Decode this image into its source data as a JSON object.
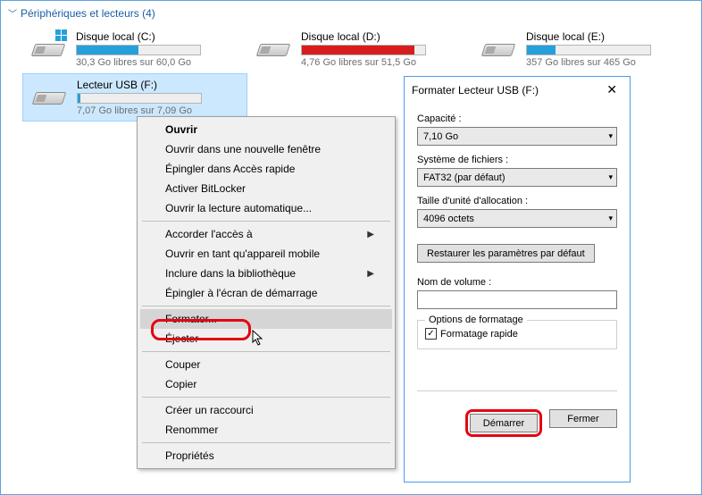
{
  "section": {
    "title": "Périphériques et lecteurs (4)"
  },
  "drives": [
    {
      "name": "Disque local (C:)",
      "sub": "30,3 Go libres sur 60,0 Go",
      "fill_pct": 50,
      "fill_color": "blue",
      "os_logo": true,
      "selected": false
    },
    {
      "name": "Disque local (D:)",
      "sub": "4,76 Go libres sur 51,5 Go",
      "fill_pct": 91,
      "fill_color": "red",
      "os_logo": false,
      "selected": false
    },
    {
      "name": "Disque local (E:)",
      "sub": "357 Go libres sur 465 Go",
      "fill_pct": 23,
      "fill_color": "blue",
      "os_logo": false,
      "selected": false
    },
    {
      "name": "Lecteur USB (F:)",
      "sub": "7,07 Go libres sur 7,09 Go",
      "fill_pct": 2,
      "fill_color": "blue",
      "os_logo": false,
      "selected": true
    }
  ],
  "context_menu": {
    "items": [
      {
        "label": "Ouvrir",
        "bold": true
      },
      {
        "label": "Ouvrir dans une nouvelle fenêtre"
      },
      {
        "label": "Épingler dans Accès rapide"
      },
      {
        "label": "Activer BitLocker"
      },
      {
        "label": "Ouvrir la lecture automatique..."
      },
      {
        "sep": true
      },
      {
        "label": "Accorder l'accès à",
        "submenu": true
      },
      {
        "label": "Ouvrir en tant qu'appareil mobile"
      },
      {
        "label": "Inclure dans la bibliothèque",
        "submenu": true
      },
      {
        "label": "Épingler à l'écran de démarrage"
      },
      {
        "sep": true
      },
      {
        "label": "Formater...",
        "hovered": true
      },
      {
        "label": "Éjecter"
      },
      {
        "sep": true
      },
      {
        "label": "Couper"
      },
      {
        "label": "Copier"
      },
      {
        "sep": true
      },
      {
        "label": "Créer un raccourci"
      },
      {
        "label": "Renommer"
      },
      {
        "sep": true
      },
      {
        "label": "Propriétés"
      }
    ]
  },
  "dialog": {
    "title": "Formater Lecteur USB (F:)",
    "capacity_label": "Capacité :",
    "capacity_value": "7,10 Go",
    "fs_label": "Système de fichiers :",
    "fs_value": "FAT32 (par défaut)",
    "alloc_label": "Taille d'unité d'allocation :",
    "alloc_value": "4096 octets",
    "restore_btn": "Restaurer les paramètres par défaut",
    "volume_label": "Nom de volume :",
    "volume_value": "",
    "options_legend": "Options de formatage",
    "quick_label": "Formatage rapide",
    "quick_checked": true,
    "start_btn": "Démarrer",
    "close_btn": "Fermer"
  }
}
